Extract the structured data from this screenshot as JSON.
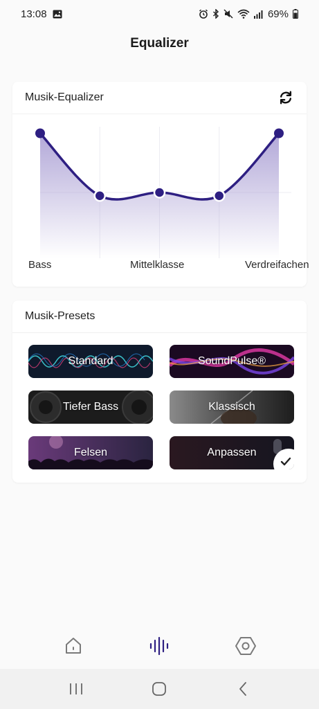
{
  "status_bar": {
    "time": "13:08",
    "battery": "69%"
  },
  "header": {
    "title": "Equalizer"
  },
  "equalizer_card": {
    "title": "Musik-Equalizer",
    "refresh_icon": "refresh-icon",
    "band_labels": [
      "Bass",
      "Mittelklasse",
      "Verdreifachen"
    ],
    "accent_color": "#2e1f82",
    "fill_color": "#b2a8d8"
  },
  "chart_data": {
    "type": "line",
    "x": [
      1,
      2,
      3,
      4,
      5
    ],
    "values": [
      0.9,
      -0.05,
      0.0,
      -0.05,
      0.9
    ],
    "ylim": [
      -1,
      1
    ],
    "tick_labels": [
      "Bass",
      "Mittelklasse",
      "Verdreifachen"
    ],
    "grid": true
  },
  "presets_card": {
    "title": "Musik-Presets",
    "items": [
      {
        "label": "Standard",
        "theme": "waves-teal",
        "selected": false
      },
      {
        "label": "SoundPulse®",
        "theme": "waves-magenta",
        "selected": false
      },
      {
        "label": "Tiefer Bass",
        "theme": "speaker-dark",
        "selected": false
      },
      {
        "label": "Klassisch",
        "theme": "violin-gray",
        "selected": false
      },
      {
        "label": "Felsen",
        "theme": "concert-purple",
        "selected": false
      },
      {
        "label": "Anpassen",
        "theme": "microphone-dark",
        "selected": true
      }
    ]
  },
  "bottom_nav": {
    "items": [
      {
        "icon": "home-icon",
        "active": false
      },
      {
        "icon": "equalizer-icon",
        "active": true
      },
      {
        "icon": "settings-hexagon-icon",
        "active": false
      }
    ],
    "active_color": "#2e1f82",
    "inactive_color": "#7a7a7a"
  },
  "system_nav": {
    "items": [
      "recents-icon",
      "home-button-icon",
      "back-icon"
    ]
  }
}
